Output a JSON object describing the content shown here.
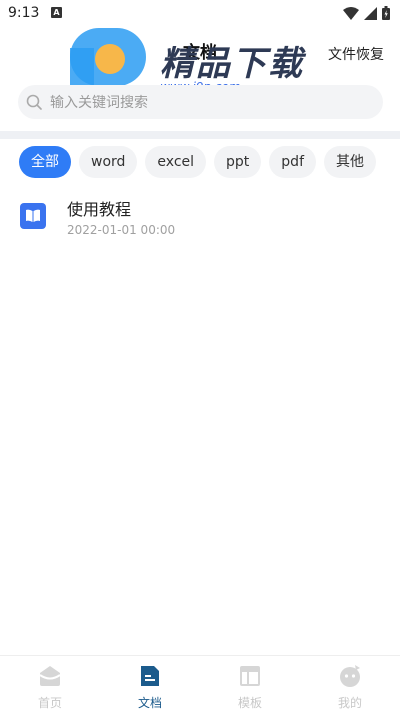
{
  "status_bar": {
    "time": "9:13",
    "notification_letter": "A"
  },
  "header": {
    "title": "文档",
    "recover_label": "文件恢复"
  },
  "watermark": {
    "text": "精品下载",
    "url": "www.j9p.com"
  },
  "search": {
    "placeholder": "输入关键词搜索"
  },
  "filters": [
    {
      "label": "全部",
      "active": true
    },
    {
      "label": "word",
      "active": false
    },
    {
      "label": "excel",
      "active": false
    },
    {
      "label": "ppt",
      "active": false
    },
    {
      "label": "pdf",
      "active": false
    },
    {
      "label": "其他",
      "active": false
    }
  ],
  "documents": [
    {
      "name": "使用教程",
      "date": "2022-01-01 00:00",
      "icon": "book-icon"
    }
  ],
  "nav": [
    {
      "label": "首页",
      "icon": "home-icon",
      "active": false
    },
    {
      "label": "文档",
      "icon": "document-icon",
      "active": true
    },
    {
      "label": "模板",
      "icon": "template-icon",
      "active": false
    },
    {
      "label": "我的",
      "icon": "profile-icon",
      "active": false
    }
  ],
  "colors": {
    "accent": "#2f7cf6",
    "nav_active": "#1c5b8c",
    "doc_icon": "#3a73ef"
  }
}
